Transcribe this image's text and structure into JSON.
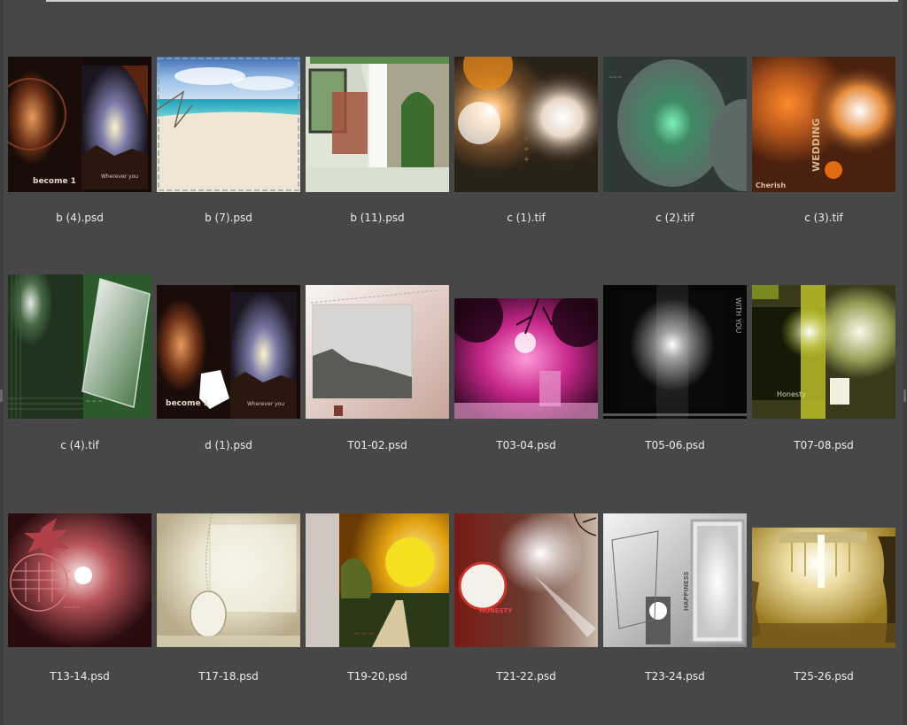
{
  "files": [
    {
      "name": "b (4).psd",
      "thumb_text": "become 1",
      "thumb_text2": "For\nWherever you"
    },
    {
      "name": "b (7).psd"
    },
    {
      "name": "b (11).psd"
    },
    {
      "name": "c (1).tif"
    },
    {
      "name": "c (2).tif"
    },
    {
      "name": "c (3).tif",
      "thumb_text": "Cherish",
      "thumb_text2": "WEDDING"
    },
    {
      "name": "c (4).tif"
    },
    {
      "name": "d (1).psd",
      "thumb_text": "become 1",
      "thumb_text2": "For\nWherever you"
    },
    {
      "name": "T01-02.psd"
    },
    {
      "name": "T03-04.psd"
    },
    {
      "name": "T05-06.psd",
      "thumb_text2": "WITH YOU"
    },
    {
      "name": "T07-08.psd",
      "thumb_text": "Honesty"
    },
    {
      "name": "T13-14.psd"
    },
    {
      "name": "T17-18.psd"
    },
    {
      "name": "T19-20.psd"
    },
    {
      "name": "T21-22.psd",
      "thumb_text": "HONESTY"
    },
    {
      "name": "T23-24.psd",
      "thumb_text2": "HAPPINESS"
    },
    {
      "name": "T25-26.psd"
    }
  ],
  "colors": {
    "background": "#474747",
    "caption": "#ececec"
  }
}
